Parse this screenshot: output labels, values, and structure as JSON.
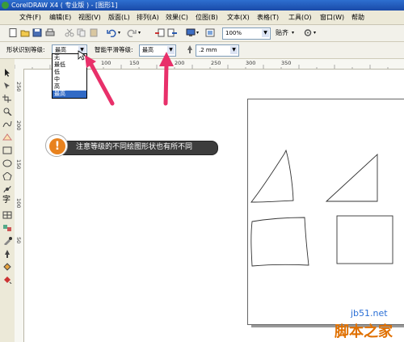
{
  "window": {
    "title": "CorelDRAW X4 ( 专业版 ) - [图形1]"
  },
  "menu": {
    "items": [
      "文件(F)",
      "编辑(E)",
      "视图(V)",
      "版面(L)",
      "排列(A)",
      "效果(C)",
      "位图(B)",
      "文本(X)",
      "表格(T)",
      "工具(O)",
      "窗口(W)",
      "帮助"
    ]
  },
  "toolbar": {
    "zoom_value": "100%",
    "snap_label": "贴齐"
  },
  "propbar": {
    "shape_recognition_label": "形状识别等级:",
    "shape_recognition_value": "最高",
    "smoothing_label": "智能平滑等级:",
    "smoothing_value": "最高",
    "outline_width": ".2 mm"
  },
  "dropdown": {
    "options": [
      "无",
      "最低",
      "低",
      "中",
      "高",
      "最高"
    ],
    "selected_index": 5
  },
  "ruler": {
    "h_ticks": [
      "50",
      "100",
      "150",
      "200",
      "250",
      "300",
      "350"
    ],
    "v_ticks": [
      "250",
      "200",
      "150",
      "100",
      "50"
    ]
  },
  "callout": {
    "text": "注意等级的不同绘图形状也有所不同",
    "icon": "!"
  },
  "watermark": {
    "url": "jb51.net",
    "site": "脚本之家"
  },
  "colors": {
    "accent_arrow": "#e8306a",
    "tip_icon": "#e8821e",
    "selection": "#316ac5"
  }
}
